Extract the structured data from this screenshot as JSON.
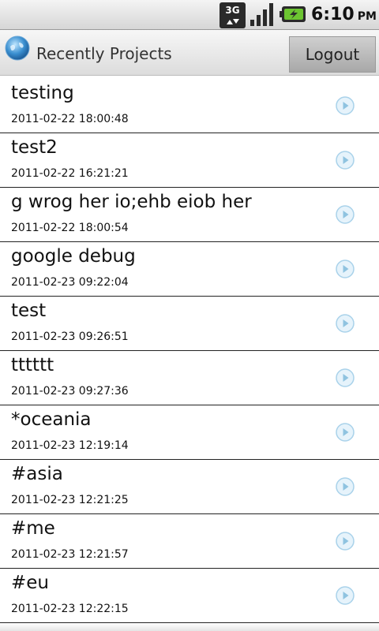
{
  "status_bar": {
    "network_label": "3G",
    "network_icon": "3g-data-icon",
    "signal_icon": "signal-strength-icon",
    "battery_icon": "battery-charging-icon",
    "time": "6:10",
    "ampm": "PM"
  },
  "header": {
    "logo_icon": "app-globe-logo-icon",
    "title": "Recently Projects",
    "logout_label": "Logout"
  },
  "projects": [
    {
      "name": "testing",
      "date": "2011-02-22 18:00:48"
    },
    {
      "name": "test2",
      "date": "2011-02-22 16:21:21"
    },
    {
      "name": "g wrog her io;ehb eiob her",
      "date": "2011-02-22 18:00:54"
    },
    {
      "name": "google debug",
      "date": "2011-02-23 09:22:04"
    },
    {
      "name": "test",
      "date": "2011-02-23 09:26:51"
    },
    {
      "name": "tttttt",
      "date": "2011-02-23 09:27:36"
    },
    {
      "name": "*oceania",
      "date": "2011-02-23 12:19:14"
    },
    {
      "name": "#asia",
      "date": "2011-02-23 12:21:25"
    },
    {
      "name": "#me",
      "date": "2011-02-23 12:21:57"
    },
    {
      "name": "#eu",
      "date": "2011-02-23 12:22:15"
    }
  ],
  "colors": {
    "arrow_blue": "#8fc3e0",
    "divider": "#222222"
  }
}
